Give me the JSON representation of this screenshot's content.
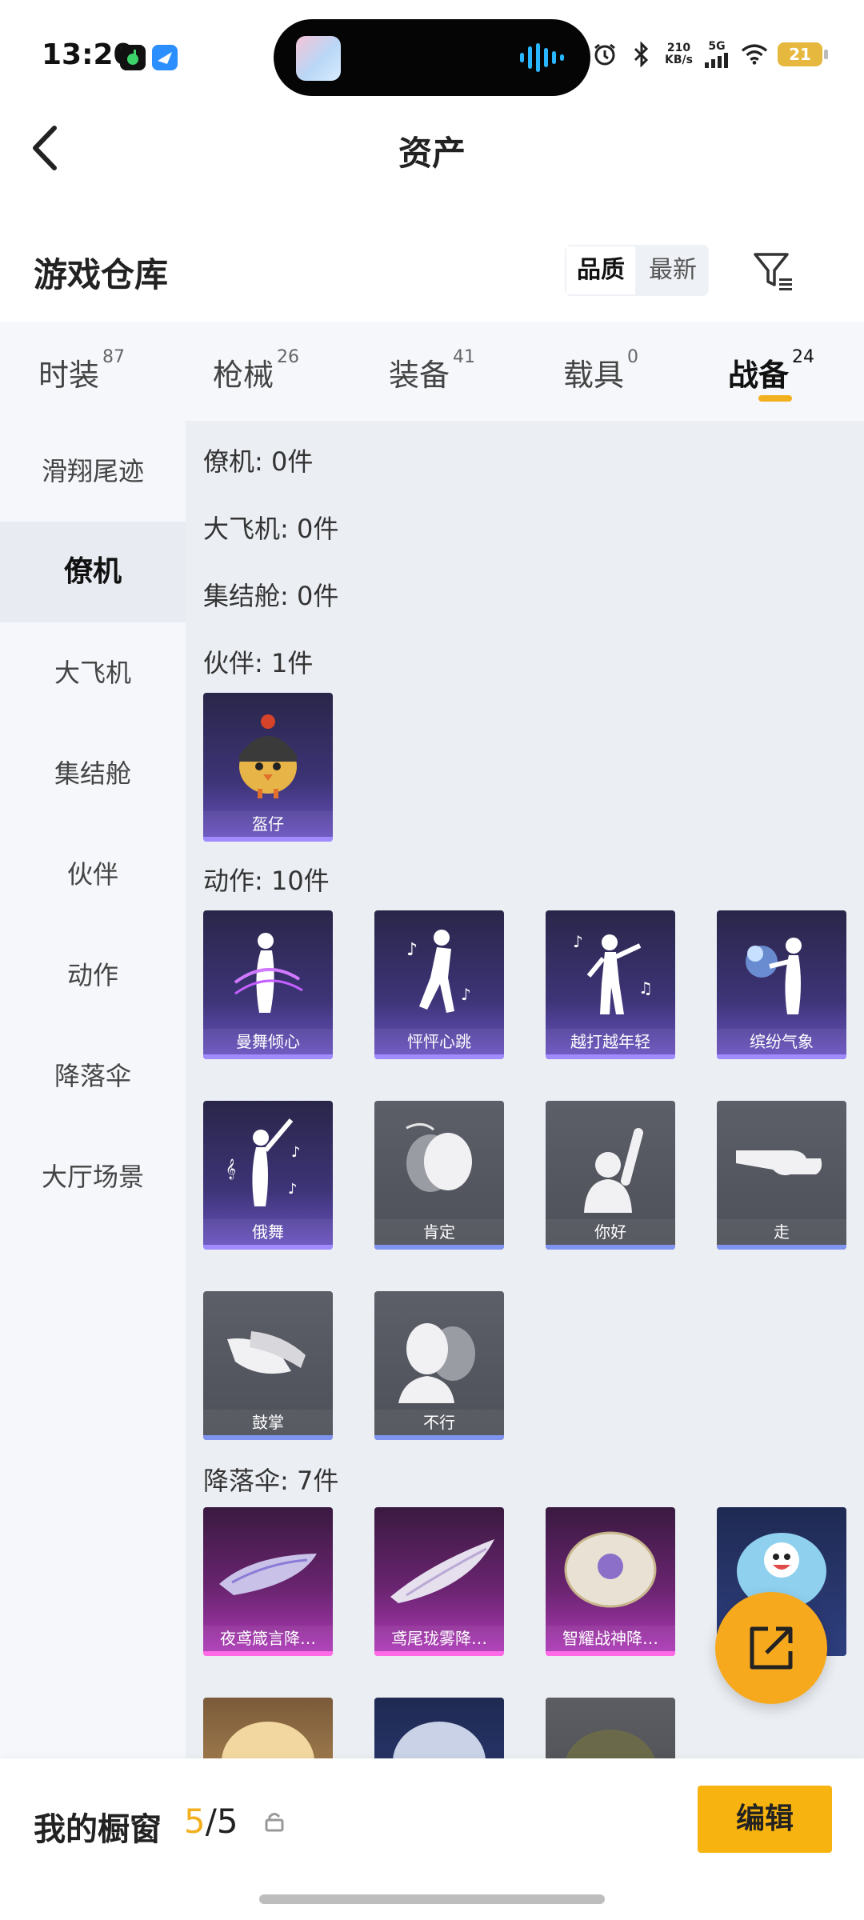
{
  "status_bar": {
    "time": "13:20",
    "net_speed_value": "210",
    "net_speed_unit": "KB/s",
    "network": "5G",
    "battery": "21"
  },
  "header": {
    "title": "资产"
  },
  "warehouse": {
    "title": "游戏仓库",
    "sort_options": [
      "品质",
      "最新"
    ],
    "active_sort": "品质"
  },
  "tabs": [
    {
      "label": "时装",
      "count": "87"
    },
    {
      "label": "枪械",
      "count": "26"
    },
    {
      "label": "装备",
      "count": "41"
    },
    {
      "label": "载具",
      "count": "0"
    },
    {
      "label": "战备",
      "count": "24"
    }
  ],
  "active_tab": "战备",
  "sidebar": {
    "items": [
      "滑翔尾迹",
      "僚机",
      "大飞机",
      "集结舱",
      "伙伴",
      "动作",
      "降落伞",
      "大厅场景"
    ],
    "active": "僚机"
  },
  "groups": {
    "wingman": "僚机: 0件",
    "plane": "大飞机: 0件",
    "pod": "集结舱: 0件",
    "partner": "伙伴: 1件",
    "action": "动作: 10件",
    "parachute": "降落伞: 7件"
  },
  "partner_items": [
    "盔仔"
  ],
  "action_items": [
    "曼舞倾心",
    "怦怦心跳",
    "越打越年轻",
    "缤纷气象",
    "俄舞",
    "肯定",
    "你好",
    "走",
    "鼓掌",
    "不行"
  ],
  "parachute_items": [
    "夜鸢箴言降…",
    "鸢尾珑雾降…",
    "智耀战神降…"
  ],
  "bottom": {
    "window_label": "我的橱窗",
    "current": "5",
    "separator": "/",
    "total": "5",
    "edit_label": "编辑"
  },
  "colors": {
    "accent": "#f2b01e",
    "purple_card": "#3d3477",
    "grey_card": "#55575f",
    "pink_card": "#6a2470"
  }
}
